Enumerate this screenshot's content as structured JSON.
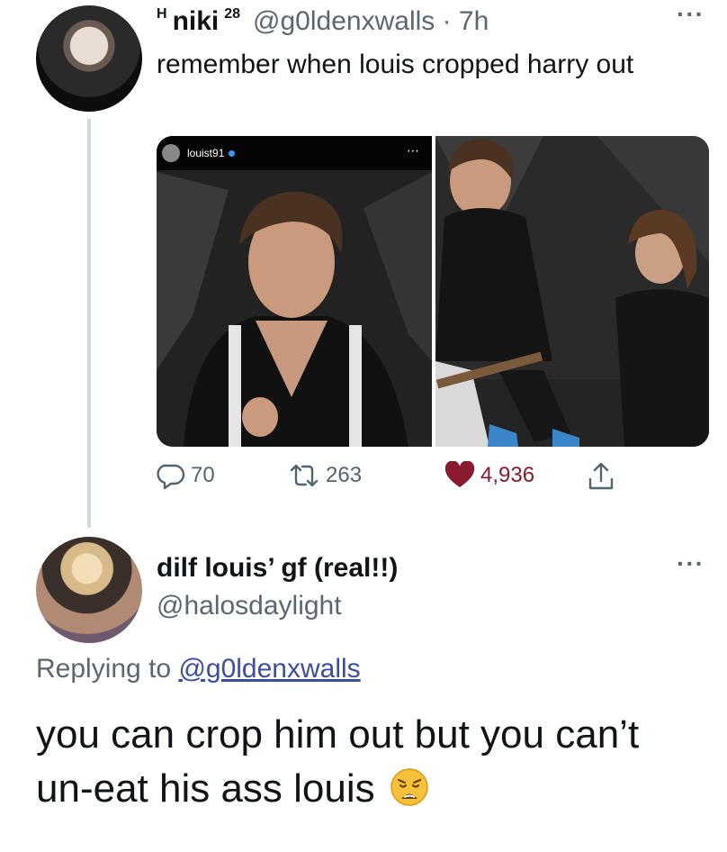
{
  "tweet": {
    "prefix": "H",
    "name": "niki",
    "name_suffix": "28",
    "handle_time": "@g0ldenxwalls · 7h",
    "more": "···",
    "text": "remember when louis cropped harry out",
    "media": {
      "ig_username": "louist91"
    },
    "stats": {
      "replies": "70",
      "retweets": "263",
      "likes": "4,936"
    },
    "like_color": "#8a1a30"
  },
  "reply": {
    "name": "dilf louis’ gf (real!!)",
    "handle": "@halosdaylight",
    "more": "···",
    "replying_label": "Replying to",
    "replying_handle": "@g0ldenxwalls",
    "text": "you can crop him out but you can’t un-eat his ass louis",
    "emoji": "weary-face-emoji"
  }
}
